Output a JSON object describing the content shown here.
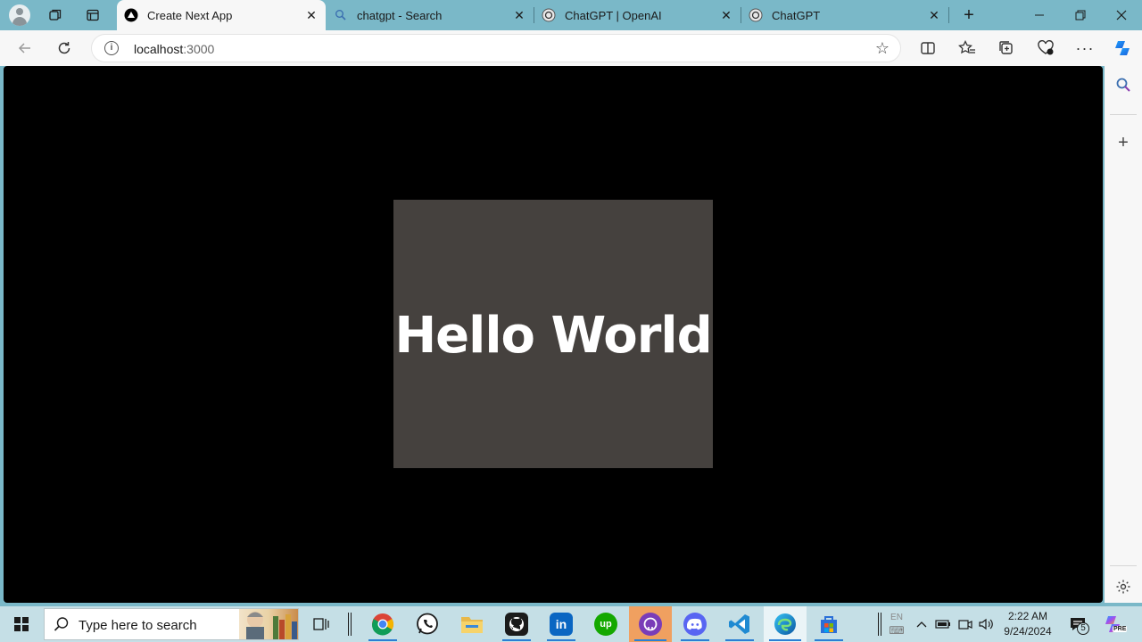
{
  "browser": {
    "tabs": [
      {
        "title": "Create Next App",
        "active": true
      },
      {
        "title": "chatgpt - Search",
        "active": false
      },
      {
        "title": "ChatGPT | OpenAI",
        "active": false
      },
      {
        "title": "ChatGPT",
        "active": false
      }
    ],
    "address": {
      "host": "localhost",
      "port": ":3000"
    }
  },
  "page": {
    "heading": "Hello World"
  },
  "taskbar": {
    "search_placeholder": "Type here to search",
    "language": "EN",
    "time": "2:22 AM",
    "date": "9/24/2024",
    "notification_count": "5",
    "copilot_badge": "PRE"
  },
  "colors": {
    "tabstrip": "#7ab8c8",
    "toolbar": "#f7f7f7",
    "content_bg": "#000000",
    "card_bg": "#45413e",
    "taskbar": "#c5dfe6"
  }
}
